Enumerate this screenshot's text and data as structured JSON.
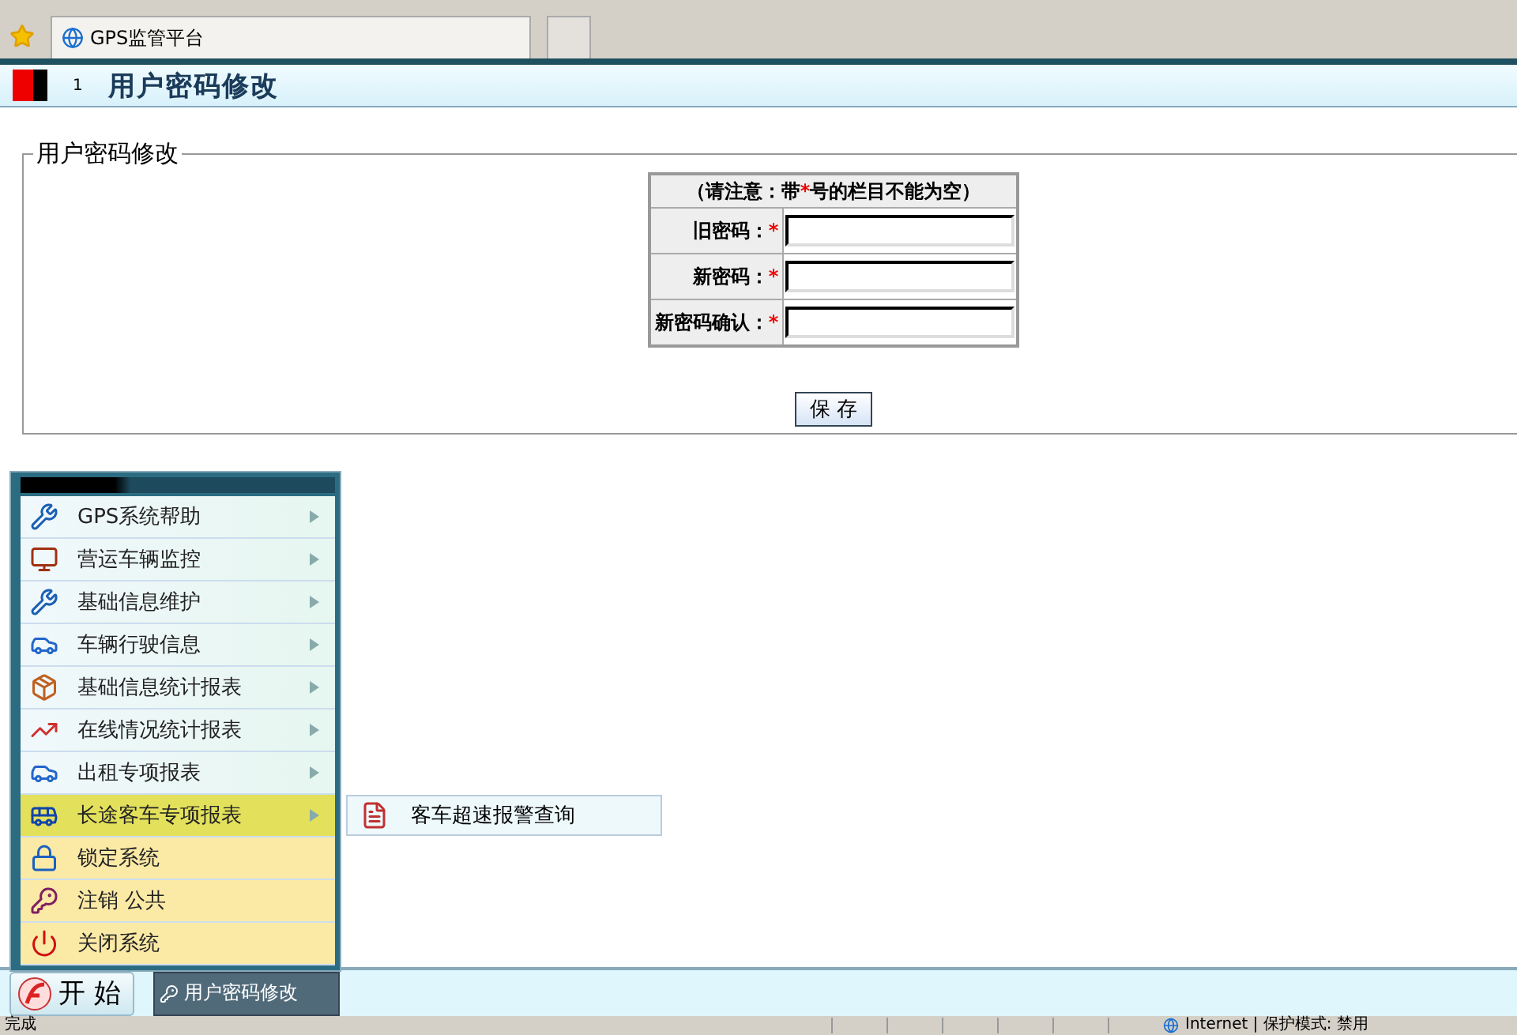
{
  "browser": {
    "tab_title": "GPS监管平台"
  },
  "header": {
    "number": "1",
    "title": "用户密码修改"
  },
  "form": {
    "legend": "用户密码修改",
    "note": {
      "before": "（请注意：带",
      "mark": "*",
      "after": "号的栏目不能为空）"
    },
    "fields": [
      {
        "label": "旧密码：",
        "required_mark": "*"
      },
      {
        "label": "新密码：",
        "required_mark": "*"
      },
      {
        "label": "新密码确认：",
        "required_mark": "*"
      }
    ],
    "save_button": "保 存"
  },
  "start_menu": {
    "items": [
      {
        "label": "GPS系统帮助",
        "kind": "submenu",
        "selected": false
      },
      {
        "label": "营运车辆监控",
        "kind": "submenu",
        "selected": false
      },
      {
        "label": "基础信息维护",
        "kind": "submenu",
        "selected": false
      },
      {
        "label": "车辆行驶信息",
        "kind": "submenu",
        "selected": false
      },
      {
        "label": "基础信息统计报表",
        "kind": "submenu",
        "selected": false
      },
      {
        "label": "在线情况统计报表",
        "kind": "submenu",
        "selected": false
      },
      {
        "label": "出租专项报表",
        "kind": "submenu",
        "selected": false
      },
      {
        "label": "长途客车专项报表",
        "kind": "submenu",
        "selected": true
      },
      {
        "label": "锁定系统",
        "kind": "action",
        "selected": false
      },
      {
        "label": "注销 公共",
        "kind": "action",
        "selected": false
      },
      {
        "label": "关闭系统",
        "kind": "action",
        "selected": false
      }
    ],
    "submenu": [
      {
        "label": "客车超速报警查询"
      }
    ]
  },
  "taskbar": {
    "start": "开 始",
    "tasks": [
      {
        "label": "用户密码修改"
      }
    ]
  },
  "status_bar": {
    "left": "完成",
    "zone": "Internet | 保护模式: 禁用"
  }
}
